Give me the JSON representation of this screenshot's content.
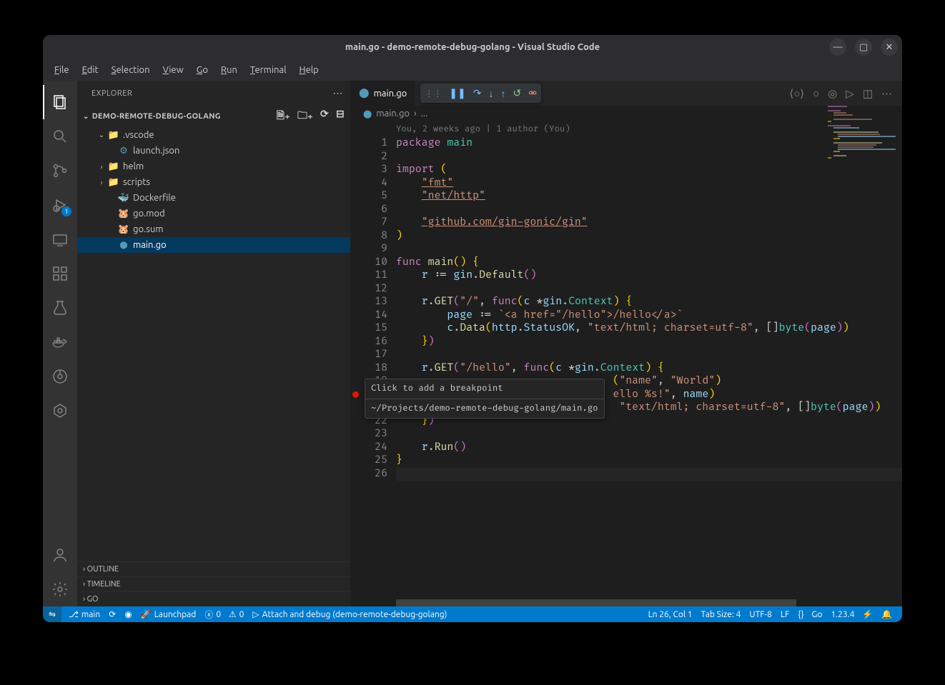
{
  "title": "main.go - demo-remote-debug-golang - Visual Studio Code",
  "menu": [
    "File",
    "Edit",
    "Selection",
    "View",
    "Go",
    "Run",
    "Terminal",
    "Help"
  ],
  "explorer": {
    "title": "EXPLORER",
    "project": "DEMO-REMOTE-DEBUG-GOLANG",
    "tree": [
      {
        "depth": 1,
        "chev": "v",
        "icon": "📁",
        "iconColor": "#4e94ce",
        "label": ".vscode",
        "kind": "folder"
      },
      {
        "depth": 2,
        "chev": "",
        "icon": "⚙",
        "iconColor": "#519aba",
        "label": "launch.json",
        "kind": "file"
      },
      {
        "depth": 1,
        "chev": ">",
        "icon": "📁",
        "iconColor": "#c09553",
        "label": "helm",
        "kind": "folder"
      },
      {
        "depth": 1,
        "chev": ">",
        "icon": "📁",
        "iconColor": "#aaa",
        "label": "scripts",
        "kind": "folder"
      },
      {
        "depth": 2,
        "chev": "",
        "icon": "🐳",
        "iconColor": "#0db7ed",
        "label": "Dockerfile",
        "kind": "file"
      },
      {
        "depth": 2,
        "chev": "",
        "icon": "🐹",
        "iconColor": "#ce3262",
        "label": "go.mod",
        "kind": "file"
      },
      {
        "depth": 2,
        "chev": "",
        "icon": "🐹",
        "iconColor": "#ce3262",
        "label": "go.sum",
        "kind": "file"
      },
      {
        "depth": 2,
        "chev": "",
        "icon": "Go",
        "iconColor": "#519aba",
        "label": "main.go",
        "kind": "file",
        "selected": true
      }
    ],
    "panels": [
      "OUTLINE",
      "TIMELINE",
      "GO"
    ]
  },
  "tab": {
    "label": "main.go"
  },
  "breadcrumb": {
    "file": "main.go",
    "sep": "›",
    "more": "..."
  },
  "codelens": "You, 2 weeks ago | 1 author (You)",
  "tooltip": {
    "line1": "Click to add a breakpoint",
    "line2": "~/Projects/demo-remote-debug-golang/main.go"
  },
  "code_lines_count": 26,
  "status": {
    "remote": "⇋",
    "branch": "main",
    "sync": "⟳",
    "live": "◉",
    "launchpad": "Launchpad",
    "errors": "0",
    "warnings": "0",
    "debug_config": "Attach and debug (demo-remote-debug-golang)",
    "cursor": "Ln 26, Col 1",
    "tabsize": "Tab Size: 4",
    "encoding": "UTF-8",
    "eol": "LF",
    "lang": "Go",
    "version": "1.23.4",
    "bell": "🔔"
  },
  "debug_badge": "1"
}
